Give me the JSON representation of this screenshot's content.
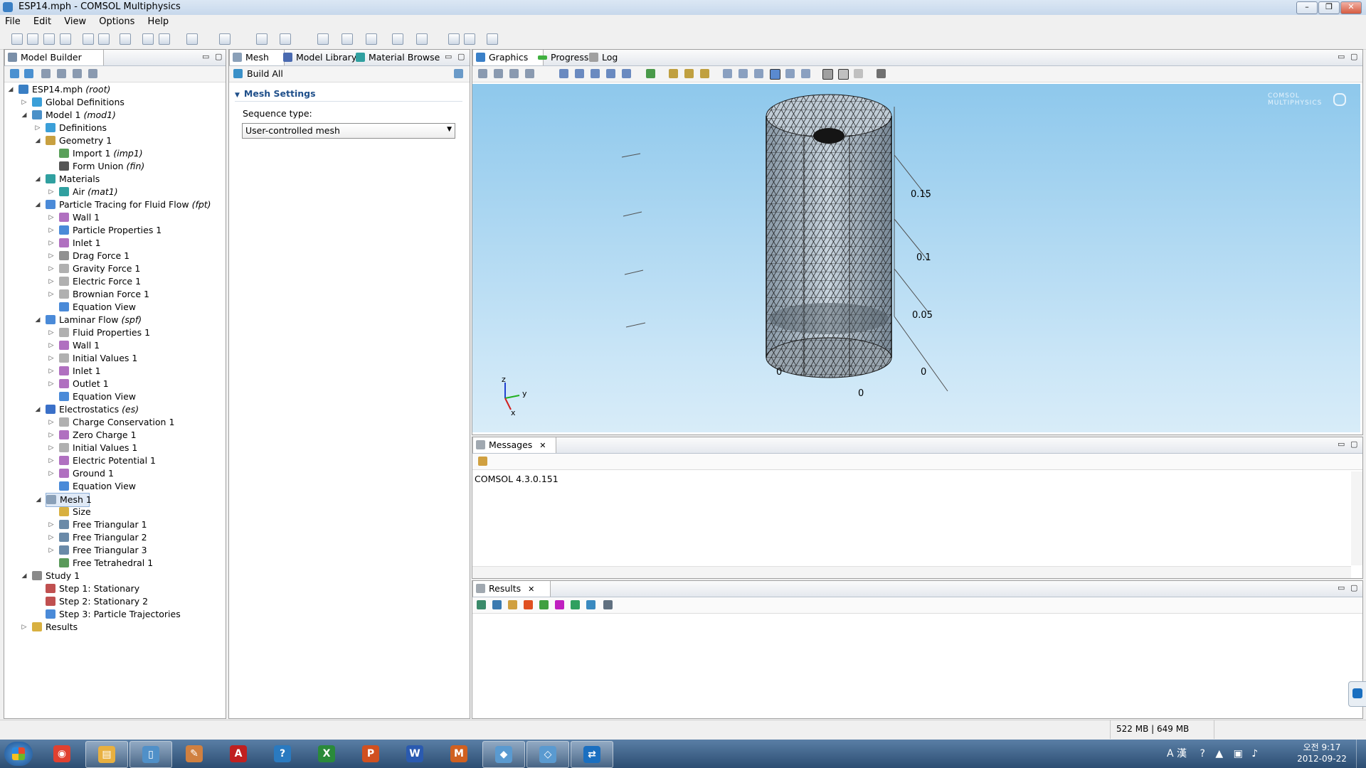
{
  "window": {
    "title": "ESP14.mph - COMSOL Multiphysics"
  },
  "menu": [
    "File",
    "Edit",
    "View",
    "Options",
    "Help"
  ],
  "model_builder": {
    "tab": "Model Builder",
    "tree": [
      {
        "label": "ESP14.mph",
        "tag": "(root)",
        "level": 0,
        "exp": "open",
        "icon": "#3a7fc4"
      },
      {
        "label": "Global Definitions",
        "tag": "",
        "level": 1,
        "exp": "closed",
        "icon": "#3b9fd8"
      },
      {
        "label": "Model 1",
        "tag": "(mod1)",
        "level": 1,
        "exp": "open",
        "icon": "#4a90c8"
      },
      {
        "label": "Definitions",
        "tag": "",
        "level": 2,
        "exp": "closed",
        "icon": "#3b9fd8"
      },
      {
        "label": "Geometry 1",
        "tag": "",
        "level": 2,
        "exp": "open",
        "icon": "#c8a040"
      },
      {
        "label": "Import 1",
        "tag": "(imp1)",
        "level": 3,
        "exp": "",
        "icon": "#5aa05a"
      },
      {
        "label": "Form Union",
        "tag": "(fin)",
        "level": 3,
        "exp": "",
        "icon": "#555555"
      },
      {
        "label": "Materials",
        "tag": "",
        "level": 2,
        "exp": "open",
        "icon": "#30a0a0"
      },
      {
        "label": "Air",
        "tag": "(mat1)",
        "level": 3,
        "exp": "closed",
        "icon": "#30a0a0"
      },
      {
        "label": "Particle Tracing for Fluid Flow",
        "tag": "(fpt)",
        "level": 2,
        "exp": "open",
        "icon": "#4a8ad8"
      },
      {
        "label": "Wall 1",
        "tag": "",
        "level": 3,
        "exp": "closed",
        "icon": "#b070c0"
      },
      {
        "label": "Particle Properties 1",
        "tag": "",
        "level": 3,
        "exp": "closed",
        "icon": "#4a8ad8"
      },
      {
        "label": "Inlet 1",
        "tag": "",
        "level": 3,
        "exp": "closed",
        "icon": "#b070c0"
      },
      {
        "label": "Drag Force 1",
        "tag": "",
        "level": 3,
        "exp": "closed",
        "icon": "#909090"
      },
      {
        "label": "Gravity Force 1",
        "tag": "",
        "level": 3,
        "exp": "closed",
        "icon": "#b0b0b0"
      },
      {
        "label": "Electric Force 1",
        "tag": "",
        "level": 3,
        "exp": "closed",
        "icon": "#b0b0b0"
      },
      {
        "label": "Brownian Force 1",
        "tag": "",
        "level": 3,
        "exp": "closed",
        "icon": "#b0b0b0"
      },
      {
        "label": "Equation View",
        "tag": "",
        "level": 3,
        "exp": "",
        "icon": "#4a8ad8"
      },
      {
        "label": "Laminar Flow",
        "tag": "(spf)",
        "level": 2,
        "exp": "open",
        "icon": "#4a8ad8"
      },
      {
        "label": "Fluid Properties 1",
        "tag": "",
        "level": 3,
        "exp": "closed",
        "icon": "#b0b0b0"
      },
      {
        "label": "Wall 1",
        "tag": "",
        "level": 3,
        "exp": "closed",
        "icon": "#b070c0"
      },
      {
        "label": "Initial Values 1",
        "tag": "",
        "level": 3,
        "exp": "closed",
        "icon": "#b0b0b0"
      },
      {
        "label": "Inlet 1",
        "tag": "",
        "level": 3,
        "exp": "closed",
        "icon": "#b070c0"
      },
      {
        "label": "Outlet 1",
        "tag": "",
        "level": 3,
        "exp": "closed",
        "icon": "#b070c0"
      },
      {
        "label": "Equation View",
        "tag": "",
        "level": 3,
        "exp": "",
        "icon": "#4a8ad8"
      },
      {
        "label": "Electrostatics",
        "tag": "(es)",
        "level": 2,
        "exp": "open",
        "icon": "#3a70c8"
      },
      {
        "label": "Charge Conservation 1",
        "tag": "",
        "level": 3,
        "exp": "closed",
        "icon": "#b0b0b0"
      },
      {
        "label": "Zero Charge 1",
        "tag": "",
        "level": 3,
        "exp": "closed",
        "icon": "#b070c0"
      },
      {
        "label": "Initial Values 1",
        "tag": "",
        "level": 3,
        "exp": "closed",
        "icon": "#b0b0b0"
      },
      {
        "label": "Electric Potential 1",
        "tag": "",
        "level": 3,
        "exp": "closed",
        "icon": "#b070c0"
      },
      {
        "label": "Ground 1",
        "tag": "",
        "level": 3,
        "exp": "closed",
        "icon": "#b070c0"
      },
      {
        "label": "Equation View",
        "tag": "",
        "level": 3,
        "exp": "",
        "icon": "#4a8ad8"
      },
      {
        "label": "Mesh 1",
        "tag": "",
        "level": 2,
        "exp": "open",
        "icon": "#8aa0b8",
        "selected": true
      },
      {
        "label": "Size",
        "tag": "",
        "level": 3,
        "exp": "",
        "icon": "#d8b040"
      },
      {
        "label": "Free Triangular 1",
        "tag": "",
        "level": 3,
        "exp": "closed",
        "icon": "#6a8aa8"
      },
      {
        "label": "Free Triangular 2",
        "tag": "",
        "level": 3,
        "exp": "closed",
        "icon": "#6a8aa8"
      },
      {
        "label": "Free Triangular 3",
        "tag": "",
        "level": 3,
        "exp": "closed",
        "icon": "#6a8aa8"
      },
      {
        "label": "Free Tetrahedral 1",
        "tag": "",
        "level": 3,
        "exp": "",
        "icon": "#5a9a5a"
      },
      {
        "label": "Study 1",
        "tag": "",
        "level": 1,
        "exp": "open",
        "icon": "#8a8a8a"
      },
      {
        "label": "Step 1: Stationary",
        "tag": "",
        "level": 2,
        "exp": "",
        "icon": "#c05050"
      },
      {
        "label": "Step 2: Stationary 2",
        "tag": "",
        "level": 2,
        "exp": "",
        "icon": "#c05050"
      },
      {
        "label": "Step 3: Particle Trajectories",
        "tag": "",
        "level": 2,
        "exp": "",
        "icon": "#4a8ad8"
      },
      {
        "label": "Results",
        "tag": "",
        "level": 1,
        "exp": "closed",
        "icon": "#d8b040"
      }
    ]
  },
  "settings": {
    "tabs": [
      "Mesh",
      "Model Library",
      "Material Browse"
    ],
    "build_all": "Build All",
    "section": "Mesh Settings",
    "sequence_label": "Sequence type:",
    "sequence_value": "User-controlled mesh"
  },
  "graphics": {
    "tabs": [
      "Graphics",
      "Progress",
      "Log"
    ],
    "watermark": "COMSOL MULTIPHYSICS",
    "axis_ticks": {
      "z": [
        "0.15",
        "0.1",
        "0.05",
        "0"
      ],
      "x": "0",
      "y": "0",
      "left": "0"
    },
    "triad": {
      "z": "z",
      "y": "y",
      "x": "x"
    }
  },
  "messages": {
    "tab": "Messages",
    "text": "COMSOL 4.3.0.151"
  },
  "results": {
    "tab": "Results"
  },
  "status": {
    "memory": "522 MB | 649 MB"
  },
  "taskbar": {
    "apps": [
      "start",
      "chrome",
      "explorer",
      "notepad",
      "paint",
      "acrobat",
      "help",
      "excel",
      "powerpoint",
      "word",
      "matlab",
      "comsol",
      "comsol2",
      "teamviewer"
    ],
    "time": "오전 9:17",
    "date": "2012-09-22"
  }
}
